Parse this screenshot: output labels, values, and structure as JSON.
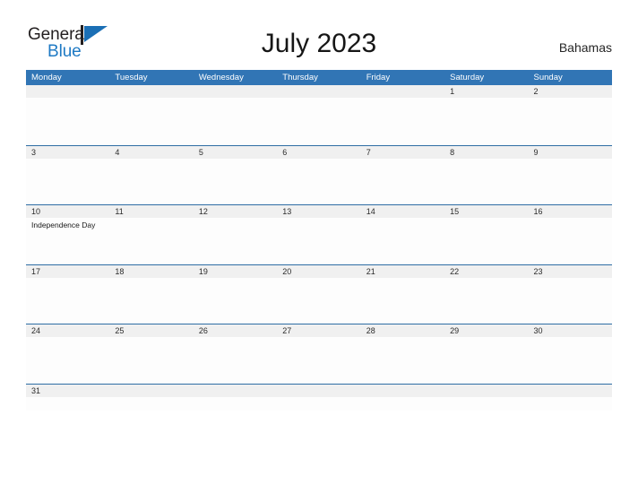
{
  "brand": {
    "name_part1": "General",
    "name_part2": "Blue",
    "mark": "flag-triangle-icon",
    "color_blue": "#1f7ac4",
    "color_dark": "#231f20"
  },
  "header": {
    "title": "July 2023",
    "country": "Bahamas"
  },
  "theme": {
    "header_blue": "#3175b5",
    "row_divider_blue": "#2e6da4",
    "date_band_gray": "#f0f0f0",
    "cell_white": "#fdfdfd",
    "text_dark": "#2b2b2b"
  },
  "calendar": {
    "weekday_headers": [
      "Monday",
      "Tuesday",
      "Wednesday",
      "Thursday",
      "Friday",
      "Saturday",
      "Sunday"
    ],
    "weeks": [
      {
        "days": [
          {
            "num": "",
            "events": []
          },
          {
            "num": "",
            "events": []
          },
          {
            "num": "",
            "events": []
          },
          {
            "num": "",
            "events": []
          },
          {
            "num": "",
            "events": []
          },
          {
            "num": "1",
            "events": []
          },
          {
            "num": "2",
            "events": []
          }
        ]
      },
      {
        "days": [
          {
            "num": "3",
            "events": []
          },
          {
            "num": "4",
            "events": []
          },
          {
            "num": "5",
            "events": []
          },
          {
            "num": "6",
            "events": []
          },
          {
            "num": "7",
            "events": []
          },
          {
            "num": "8",
            "events": []
          },
          {
            "num": "9",
            "events": []
          }
        ]
      },
      {
        "days": [
          {
            "num": "10",
            "events": [
              "Independence Day"
            ]
          },
          {
            "num": "11",
            "events": []
          },
          {
            "num": "12",
            "events": []
          },
          {
            "num": "13",
            "events": []
          },
          {
            "num": "14",
            "events": []
          },
          {
            "num": "15",
            "events": []
          },
          {
            "num": "16",
            "events": []
          }
        ]
      },
      {
        "days": [
          {
            "num": "17",
            "events": []
          },
          {
            "num": "18",
            "events": []
          },
          {
            "num": "19",
            "events": []
          },
          {
            "num": "20",
            "events": []
          },
          {
            "num": "21",
            "events": []
          },
          {
            "num": "22",
            "events": []
          },
          {
            "num": "23",
            "events": []
          }
        ]
      },
      {
        "days": [
          {
            "num": "24",
            "events": []
          },
          {
            "num": "25",
            "events": []
          },
          {
            "num": "26",
            "events": []
          },
          {
            "num": "27",
            "events": []
          },
          {
            "num": "28",
            "events": []
          },
          {
            "num": "29",
            "events": []
          },
          {
            "num": "30",
            "events": []
          }
        ]
      },
      {
        "days": [
          {
            "num": "31",
            "events": []
          },
          {
            "num": "",
            "events": []
          },
          {
            "num": "",
            "events": []
          },
          {
            "num": "",
            "events": []
          },
          {
            "num": "",
            "events": []
          },
          {
            "num": "",
            "events": []
          },
          {
            "num": "",
            "events": []
          }
        ]
      }
    ]
  }
}
